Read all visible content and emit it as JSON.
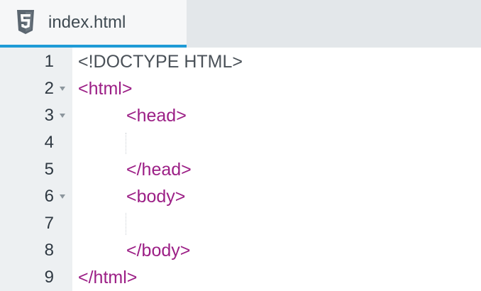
{
  "tab": {
    "filename": "index.html",
    "icon": "html5-icon"
  },
  "colors": {
    "tag": "#9c1f86",
    "doctype": "#4a5158",
    "accent": "#1f9bd6",
    "gutter_bg": "#edf0f2"
  },
  "lines": [
    {
      "number": "1",
      "text": "<!DOCTYPE HTML>",
      "foldable": false
    },
    {
      "number": "2",
      "text": "<html>",
      "foldable": true
    },
    {
      "number": "3",
      "text": "<head>",
      "foldable": true
    },
    {
      "number": "4",
      "text": "",
      "foldable": false
    },
    {
      "number": "5",
      "text": "</head>",
      "foldable": false
    },
    {
      "number": "6",
      "text": "<body>",
      "foldable": true
    },
    {
      "number": "7",
      "text": "",
      "foldable": false
    },
    {
      "number": "8",
      "text": "</body>",
      "foldable": false
    },
    {
      "number": "9",
      "text": "</html>",
      "foldable": false
    }
  ]
}
